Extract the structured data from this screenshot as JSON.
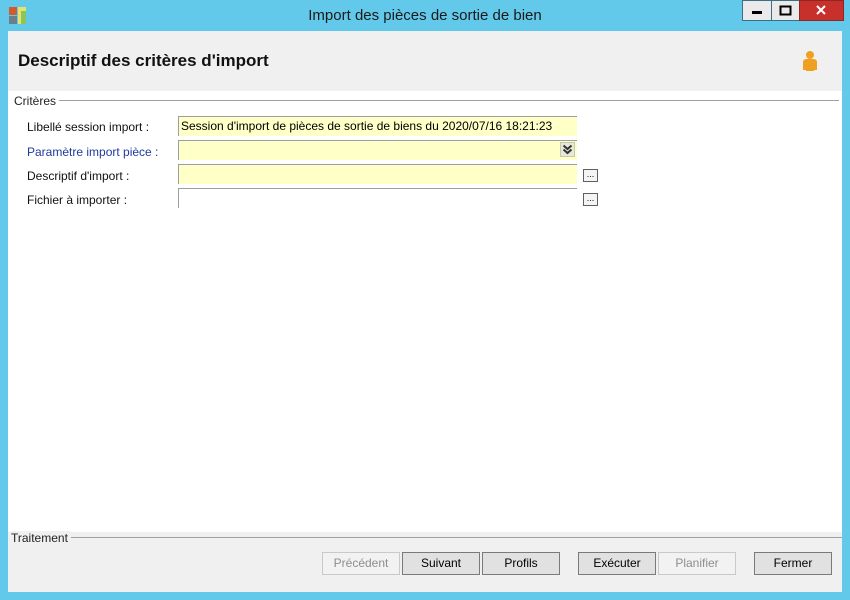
{
  "window": {
    "title": "Import des pièces de sortie de bien"
  },
  "header": {
    "title": "Descriptif des critères d'import",
    "user_icon": "user-icon"
  },
  "criteria": {
    "group_label": "Critères",
    "fields": [
      {
        "label": "Libellé session import :",
        "value": "Session d'import de pièces de sortie de biens du 2020/07/16 18:21:23"
      },
      {
        "label": "Paramètre import pièce :",
        "value": ""
      },
      {
        "label": "Descriptif d'import :",
        "value": ""
      },
      {
        "label": "Fichier à importer :",
        "value": ""
      }
    ],
    "ellipsis_label": "..."
  },
  "treatment": {
    "group_label": "Traitement"
  },
  "buttons": {
    "previous": "Précédent",
    "next": "Suivant",
    "profiles": "Profils",
    "execute": "Exécuter",
    "schedule": "Planifier",
    "close": "Fermer"
  },
  "colors": {
    "title_bar": "#63c9ea",
    "field_background": "#ffffc8",
    "link_label": "#1f3a9e",
    "close_button": "#c7302b"
  }
}
